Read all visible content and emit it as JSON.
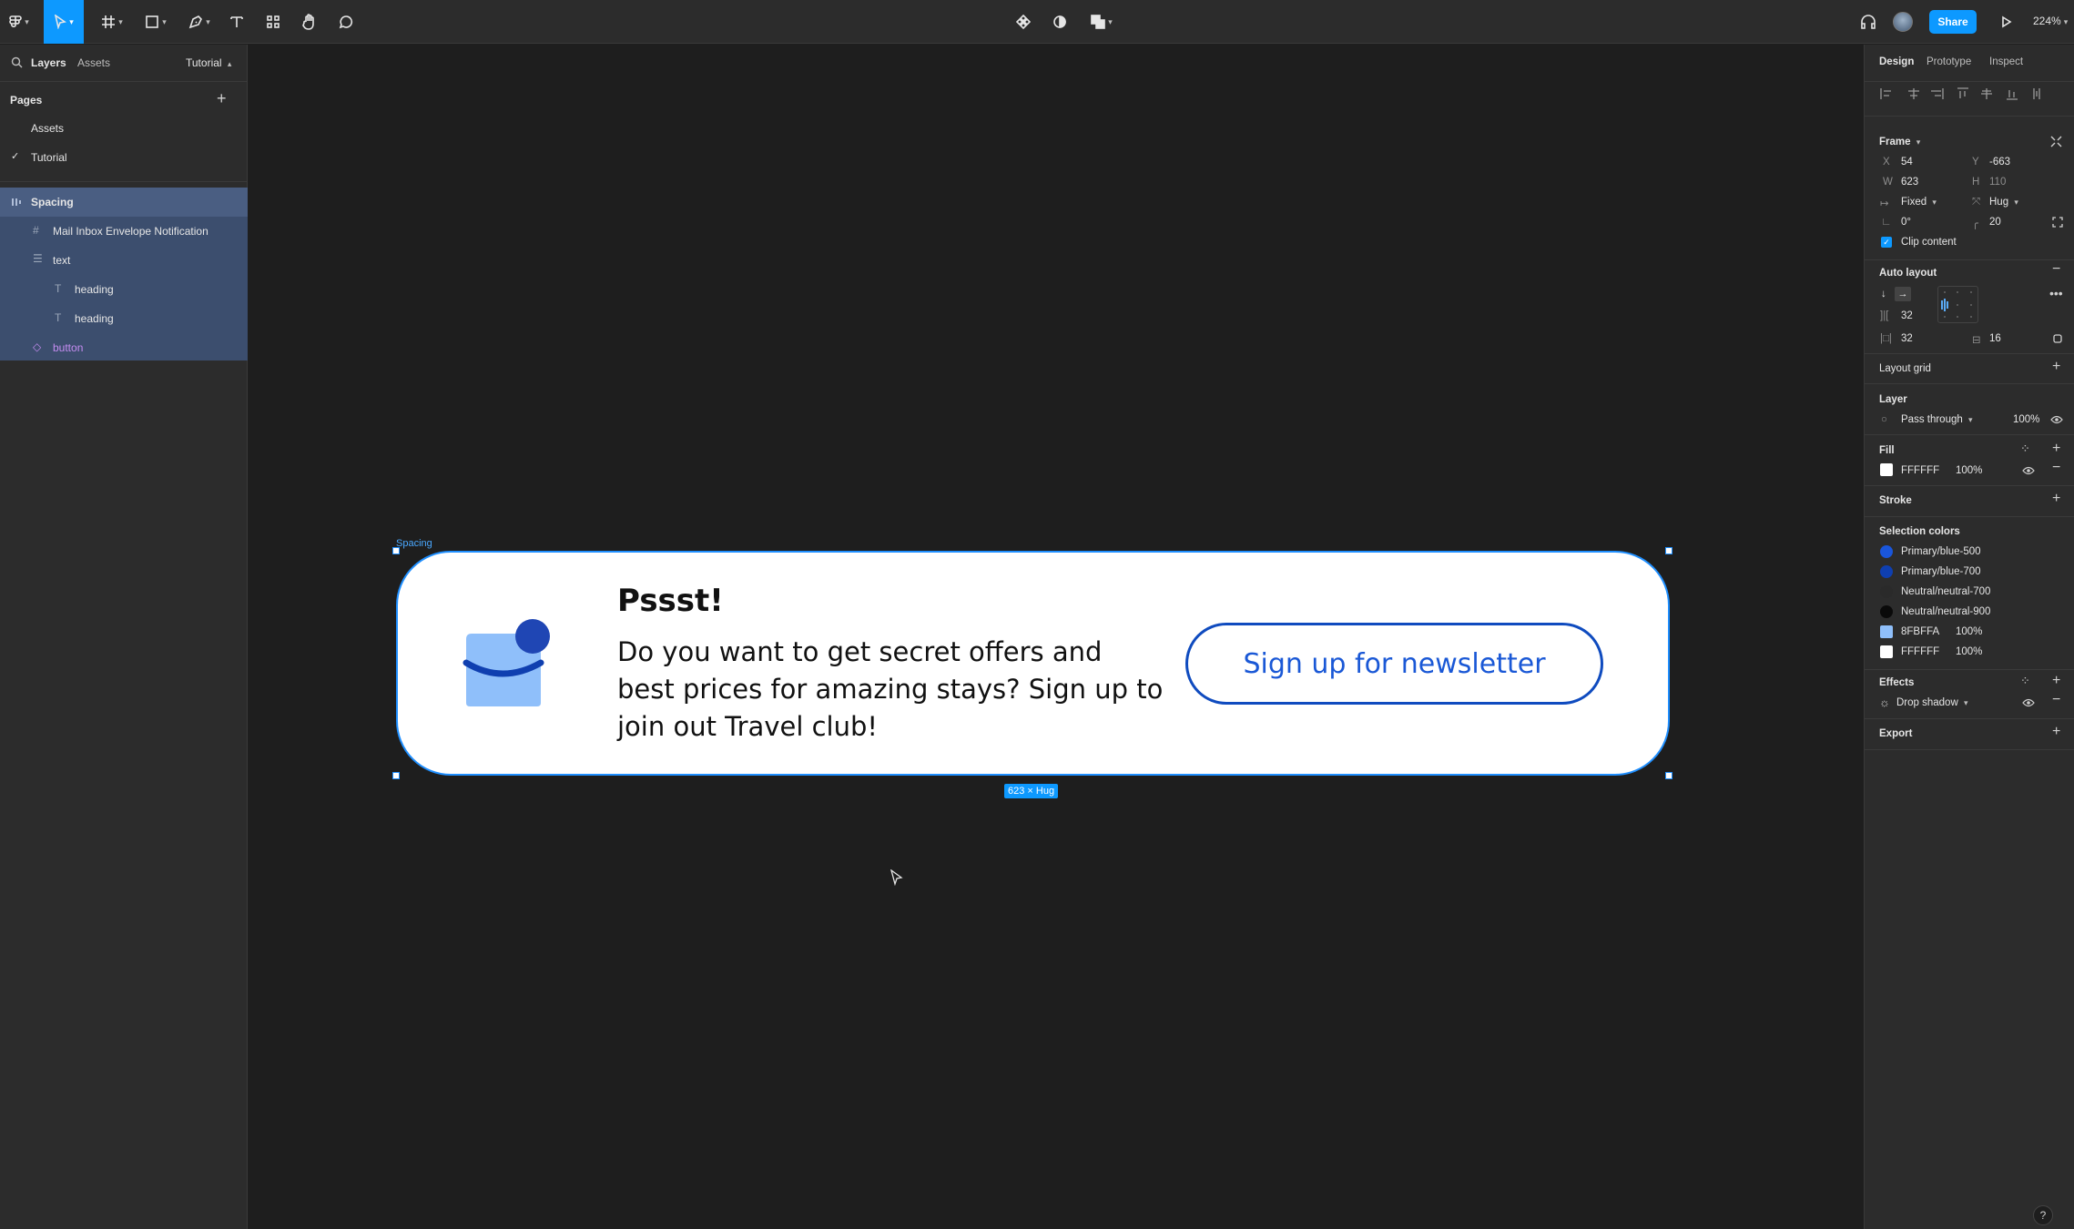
{
  "toolbar": {
    "share_label": "Share",
    "zoom": "224%"
  },
  "left_panel": {
    "tabs": [
      "Layers",
      "Assets"
    ],
    "page_switcher": "Tutorial",
    "pages_title": "Pages",
    "pages": [
      {
        "label": "Assets",
        "checked": false
      },
      {
        "label": "Tutorial",
        "checked": true
      }
    ],
    "layers": [
      {
        "label": "Spacing",
        "icon": "auto-layout-icon",
        "selected": true
      },
      {
        "label": "Mail Inbox Envelope Notification",
        "icon": "frame-icon"
      },
      {
        "label": "text",
        "icon": "auto-layout-vertical-icon"
      },
      {
        "label": "heading",
        "icon": "text-icon"
      },
      {
        "label": "heading",
        "icon": "text-icon"
      },
      {
        "label": "button",
        "icon": "component-instance-icon"
      }
    ]
  },
  "right_panel": {
    "tabs": [
      "Design",
      "Prototype",
      "Inspect"
    ],
    "frame": {
      "title": "Frame",
      "x_label": "X",
      "x": "54",
      "y_label": "Y",
      "y": "-663",
      "w_label": "W",
      "w": "623",
      "h_label": "H",
      "h": "110",
      "width_mode": "Fixed",
      "height_mode": "Hug",
      "rotation": "0°",
      "radius": "20",
      "clip_content": "Clip content"
    },
    "auto_layout": {
      "title": "Auto layout",
      "gap": "32",
      "padding_h": "32",
      "padding_v": "16"
    },
    "layout_grid": "Layout grid",
    "layer": {
      "title": "Layer",
      "blend": "Pass through",
      "opacity": "100%"
    },
    "fill": {
      "title": "Fill",
      "hex": "FFFFFF",
      "opacity": "100%",
      "color": "#FFFFFF"
    },
    "stroke": "Stroke",
    "selection_colors": {
      "title": "Selection colors",
      "items": [
        {
          "label": "Primary/blue-500",
          "color": "#1a56db",
          "shape": "dot",
          "opacity": ""
        },
        {
          "label": "Primary/blue-700",
          "color": "#0f3fb0",
          "shape": "dot",
          "opacity": ""
        },
        {
          "label": "Neutral/neutral-700",
          "color": "#2a2a2a",
          "shape": "dot",
          "opacity": ""
        },
        {
          "label": "Neutral/neutral-900",
          "color": "#0a0a0a",
          "shape": "dot",
          "opacity": ""
        },
        {
          "label": "8FBFFA",
          "color": "#8FBFFA",
          "shape": "square",
          "opacity": "100%"
        },
        {
          "label": "FFFFFF",
          "color": "#FFFFFF",
          "shape": "square",
          "opacity": "100%"
        }
      ]
    },
    "effects": {
      "title": "Effects",
      "item": "Drop shadow"
    },
    "export": "Export"
  },
  "canvas": {
    "frame_label": "Spacing",
    "size_tag": "623 × Hug",
    "card": {
      "heading": "Pssst!",
      "body": "Do you want to get secret offers and best prices for amazing stays? Sign up to join out Travel club!",
      "cta": "Sign up for newsletter",
      "icon_colors": {
        "envelope": "#8FBFFA",
        "accent": "#0f3fb0"
      }
    }
  },
  "help_label": "?"
}
